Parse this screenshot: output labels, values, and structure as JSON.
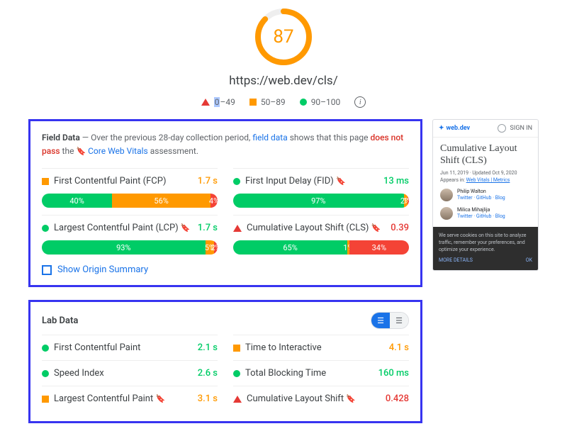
{
  "score": {
    "value": "87",
    "percent": 87,
    "color": "#f90"
  },
  "url": "https://web.dev/cls/",
  "legend": {
    "poor": "0–49",
    "poor_sel": "0",
    "poor_rest": "–49",
    "avg": "50–89",
    "good": "90–100"
  },
  "field_data": {
    "title": "Field Data",
    "intro1": " — Over the previous 28-day collection period, ",
    "link1": "field data",
    "intro2": " shows that this page ",
    "fail": "does not pass",
    "intro3": " the ",
    "cwv_icon": "🔖",
    "cwv": "Core Web Vitals",
    "intro4": " assessment.",
    "metrics": [
      {
        "shape": "square-orange",
        "name": "First Contentful Paint (FCP)",
        "bookmark": false,
        "value": "1.7 s",
        "val_color": "val-orange",
        "dist": [
          40,
          56,
          4
        ]
      },
      {
        "shape": "circle-green",
        "name": "First Input Delay (FID)",
        "bookmark": true,
        "value": "13 ms",
        "val_color": "val-green",
        "dist": [
          97,
          2,
          1
        ]
      },
      {
        "shape": "circle-green",
        "name": "Largest Contentful Paint (LCP)",
        "bookmark": true,
        "value": "1.7 s",
        "val_color": "val-green",
        "dist": [
          93,
          5,
          2
        ]
      },
      {
        "shape": "triangle-red",
        "name": "Cumulative Layout Shift (CLS)",
        "bookmark": true,
        "value": "0.39",
        "val_color": "val-red",
        "dist": [
          65,
          1,
          34
        ]
      }
    ],
    "origin": "Show Origin Summary"
  },
  "lab_data": {
    "title": "Lab Data",
    "rows": [
      {
        "shape": "circle-green",
        "name": "First Contentful Paint",
        "bookmark": false,
        "value": "2.1 s",
        "val_color": "val-green"
      },
      {
        "shape": "square-orange",
        "name": "Time to Interactive",
        "bookmark": false,
        "value": "4.1 s",
        "val_color": "val-orange"
      },
      {
        "shape": "circle-green",
        "name": "Speed Index",
        "bookmark": false,
        "value": "2.6 s",
        "val_color": "val-green"
      },
      {
        "shape": "circle-green",
        "name": "Total Blocking Time",
        "bookmark": false,
        "value": "160 ms",
        "val_color": "val-green"
      },
      {
        "shape": "square-orange",
        "name": "Largest Contentful Paint",
        "bookmark": true,
        "value": "3.1 s",
        "val_color": "val-orange"
      },
      {
        "shape": "triangle-red",
        "name": "Cumulative Layout Shift",
        "bookmark": true,
        "value": "0.428",
        "val_color": "val-red"
      }
    ]
  },
  "preview": {
    "brand": "web.dev",
    "signin": "SIGN IN",
    "title": "Cumulative Layout Shift (CLS)",
    "date": "Jun 11, 2019 · Updated Oct 9, 2020",
    "appears": "Appears in: ",
    "appears_links": "Web Vitals | Metrics",
    "authors": [
      {
        "name": "Philip Walton",
        "links": "Twitter · GitHub · Blog"
      },
      {
        "name": "Milica Mihajlija",
        "links": "Twitter · GitHub · Blog"
      }
    ],
    "cookie": "We serve cookies on this site to analyze traffic, remember your preferences, and optimize your experience.",
    "more": "MORE DETAILS",
    "ok": "OK"
  }
}
